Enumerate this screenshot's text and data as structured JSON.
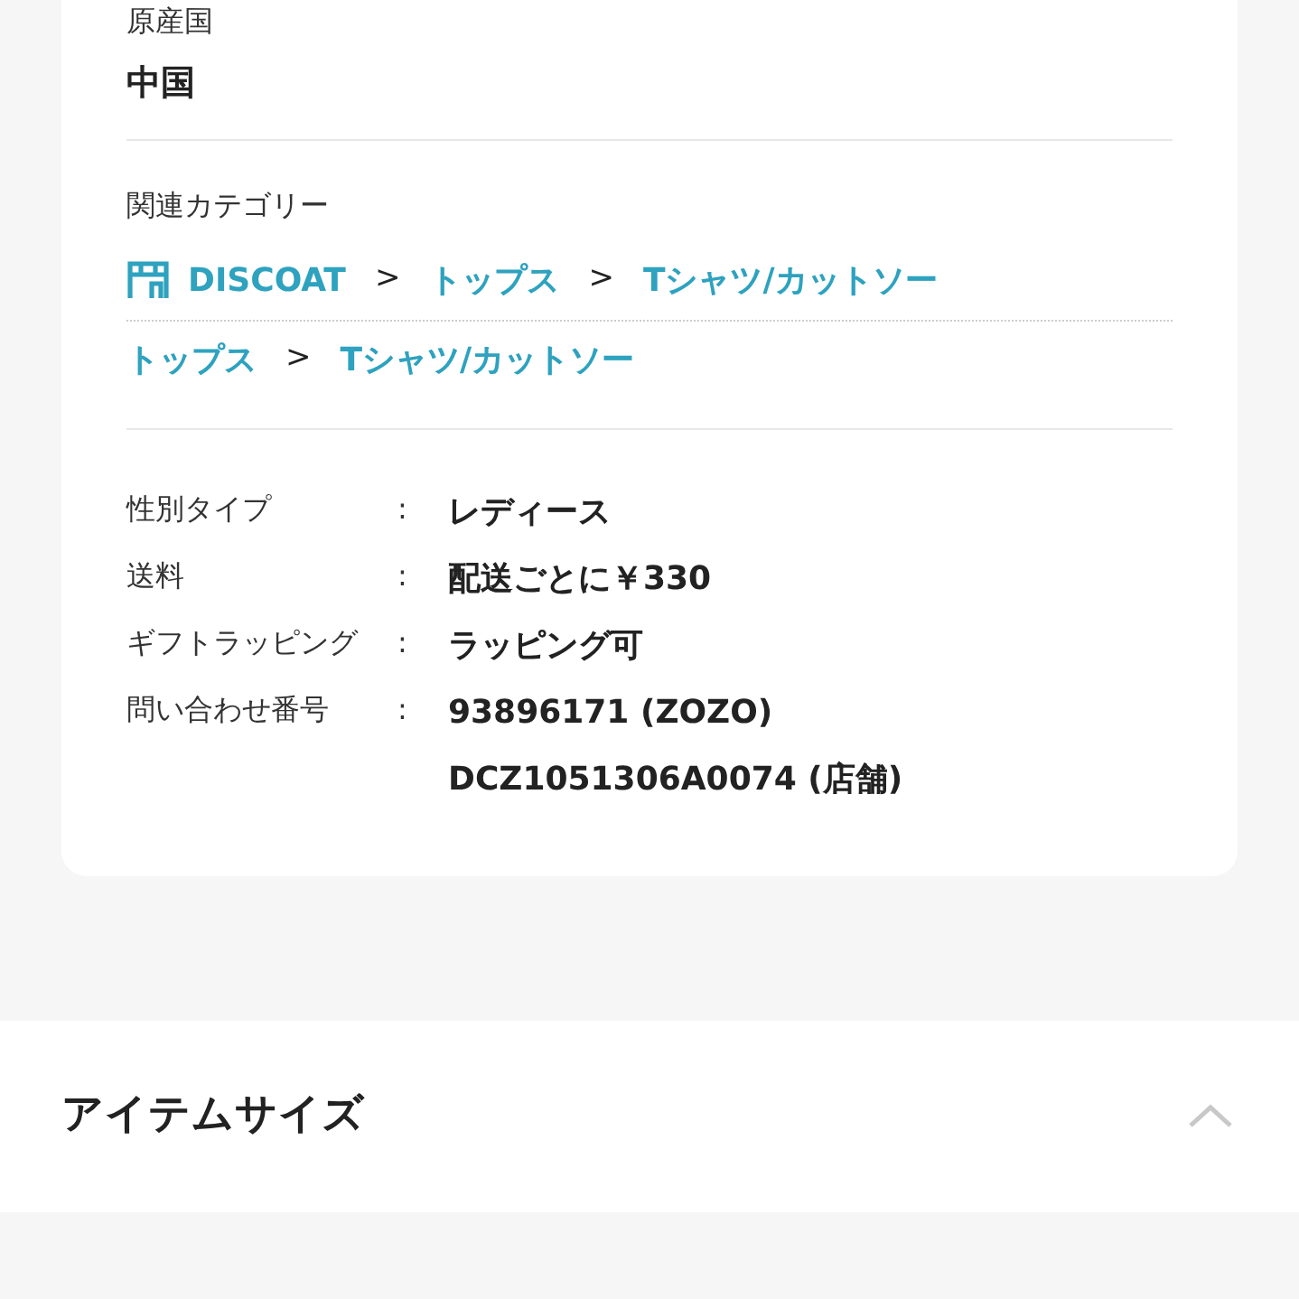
{
  "origin": {
    "label": "原産国",
    "value": "中国"
  },
  "related": {
    "label": "関連カテゴリー",
    "paths": [
      {
        "shop": true,
        "items": [
          {
            "kind": "link",
            "text": "DISCOAT"
          },
          {
            "kind": "sep",
            "text": ">"
          },
          {
            "kind": "link",
            "text": "トップス"
          },
          {
            "kind": "sep",
            "text": ">"
          },
          {
            "kind": "link",
            "text": "Tシャツ/カットソー"
          }
        ]
      },
      {
        "shop": false,
        "items": [
          {
            "kind": "link",
            "text": "トップス"
          },
          {
            "kind": "sep",
            "text": ">"
          },
          {
            "kind": "link",
            "text": "Tシャツ/カットソー"
          }
        ]
      }
    ]
  },
  "details": [
    {
      "label": "性別タイプ",
      "separator": ":",
      "values": [
        "レディース"
      ]
    },
    {
      "label": "送料",
      "separator": ":",
      "values": [
        "配送ごとに￥330"
      ]
    },
    {
      "label": "ギフトラッピング",
      "separator": ":",
      "values": [
        "ラッピング可"
      ]
    },
    {
      "label": "問い合わせ番号",
      "separator": ":",
      "values": [
        "93896171 (ZOZO)",
        "DCZ1051306A0074 (店舗)"
      ]
    }
  ],
  "section": {
    "title": "アイテムサイズ"
  }
}
